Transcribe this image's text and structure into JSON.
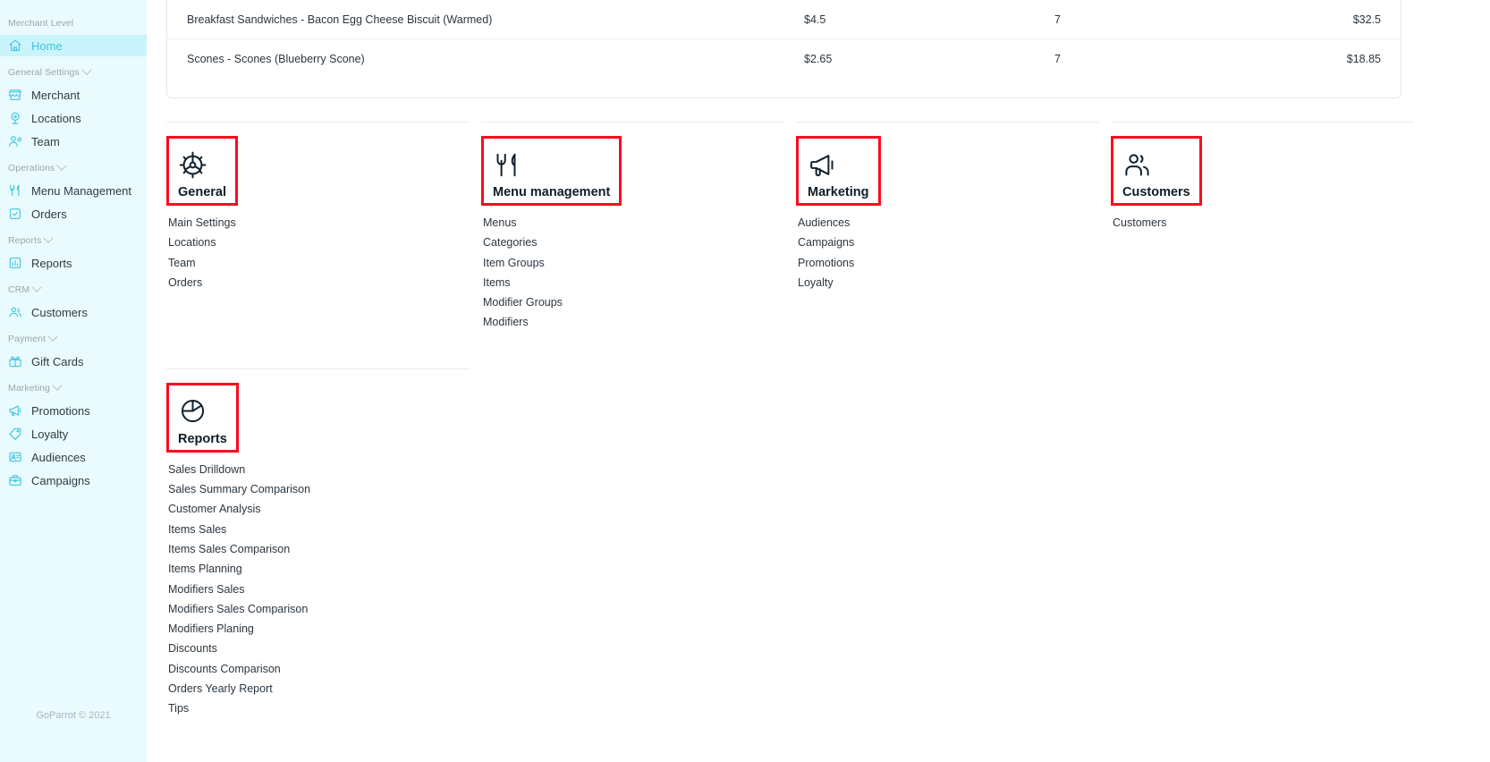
{
  "sidebar": {
    "groups": [
      {
        "title": "Merchant Level",
        "collapsible": false,
        "items": [
          {
            "label": "Home",
            "icon": "home-icon",
            "active": true
          }
        ]
      },
      {
        "title": "General Settings",
        "collapsible": true,
        "items": [
          {
            "label": "Merchant",
            "icon": "store-icon",
            "active": false
          },
          {
            "label": "Locations",
            "icon": "map-pin-icon",
            "active": false
          },
          {
            "label": "Team",
            "icon": "user-settings-icon",
            "active": false
          }
        ]
      },
      {
        "title": "Operations",
        "collapsible": true,
        "items": [
          {
            "label": "Menu Management",
            "icon": "fork-knife-icon",
            "active": false
          },
          {
            "label": "Orders",
            "icon": "checkbox-icon",
            "active": false
          }
        ]
      },
      {
        "title": "Reports",
        "collapsible": true,
        "items": [
          {
            "label": "Reports",
            "icon": "bar-chart-icon",
            "active": false
          }
        ]
      },
      {
        "title": "CRM",
        "collapsible": true,
        "items": [
          {
            "label": "Customers",
            "icon": "users-icon",
            "active": false
          }
        ]
      },
      {
        "title": "Payment",
        "collapsible": true,
        "items": [
          {
            "label": "Gift Cards",
            "icon": "gift-card-icon",
            "active": false
          }
        ]
      },
      {
        "title": "Marketing",
        "collapsible": true,
        "items": [
          {
            "label": "Promotions",
            "icon": "megaphone-icon",
            "active": false
          },
          {
            "label": "Loyalty",
            "icon": "tag-icon",
            "active": false
          },
          {
            "label": "Audiences",
            "icon": "audience-icon",
            "active": false
          },
          {
            "label": "Campaigns",
            "icon": "briefcase-icon",
            "active": false
          }
        ]
      }
    ],
    "footer": "GoParrot © 2021"
  },
  "table": {
    "rows": [
      {
        "name": "Breakfast Sandwiches - Bacon Egg Cheese Biscuit (Warmed)",
        "price": "$4.5",
        "qty": "7",
        "total": "$32.5"
      },
      {
        "name": "Scones - Scones (Blueberry Scone)",
        "price": "$2.65",
        "qty": "7",
        "total": "$18.85"
      }
    ]
  },
  "cards": {
    "row1": [
      {
        "title": "General",
        "icon": "gear-icon",
        "highlighted": true,
        "links": [
          "Main Settings",
          "Locations",
          "Team",
          "Orders"
        ]
      },
      {
        "title": "Menu management",
        "icon": "fork-knife-icon",
        "highlighted": true,
        "links": [
          "Menus",
          "Categories",
          "Item Groups",
          "Items",
          "Modifier Groups",
          "Modifiers"
        ]
      },
      {
        "title": "Marketing",
        "icon": "megaphone-icon",
        "highlighted": true,
        "links": [
          "Audiences",
          "Campaigns",
          "Promotions",
          "Loyalty"
        ]
      },
      {
        "title": "Customers",
        "icon": "customers-icon",
        "highlighted": true,
        "links": [
          "Customers"
        ]
      }
    ],
    "row2": [
      {
        "title": "Reports",
        "icon": "pie-chart-icon",
        "highlighted": true,
        "links": [
          "Sales Drilldown",
          "Sales Summary Comparison",
          "Customer Analysis",
          "Items Sales",
          "Items Sales Comparison",
          "Items Planning",
          "Modifiers Sales",
          "Modifiers Sales Comparison",
          "Modifiers Planing",
          "Discounts",
          "Discounts Comparison",
          "Orders Yearly Report",
          "Tips"
        ]
      }
    ]
  },
  "colors": {
    "sidebar_bg": "#e9fbfe",
    "accent": "#3fc4e0",
    "active_bg": "#c9f4fb",
    "highlight_box": "#fb0b1e",
    "text": "#2b3640"
  }
}
